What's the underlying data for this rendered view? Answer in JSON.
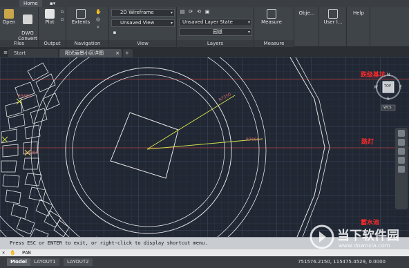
{
  "ribbon_tabs": {
    "home": "Home"
  },
  "panels": {
    "files": {
      "title": "Files",
      "open": "Open",
      "dwg_convert": "DWG\nConvert"
    },
    "output": {
      "title": "Output",
      "plot": "Plot"
    },
    "navigation": {
      "title": "Navigation",
      "extents": "Extents"
    },
    "view": {
      "title": "View",
      "visual_style": "2D Wireframe",
      "named_view": "Unsaved View"
    },
    "layers": {
      "title": "Layers",
      "layer_state": "Unsaved Layer State",
      "current_layer": "园道"
    },
    "measure": {
      "title": "Measure",
      "measure": "Measure"
    },
    "objects": {
      "title": "Obje..."
    },
    "user": {
      "title": "User I..."
    },
    "help": {
      "title": "Help"
    }
  },
  "file_tabs": {
    "start": "Start",
    "drawing": "阳光丽景小区详图"
  },
  "drawing_labels": {
    "label1": "跌级基坑",
    "label2": "路灯",
    "label3": "蓄水池",
    "dim1": "R7350",
    "dim2": "R7000",
    "dim3": "R5600",
    "dim4": "R3000"
  },
  "viewcube": {
    "north": "N",
    "south": "S",
    "east": "E",
    "west": "W",
    "top": "TOP",
    "wcs": "WCS"
  },
  "command": {
    "history": "Press ESC or ENTER to exit, or right-click to display shortcut menu.",
    "current": "PAN"
  },
  "layout_tabs": [
    "Model",
    "LAYOUT1",
    "LAYOUT2"
  ],
  "coordinates": "751576.2150, 115475.4529, 0.0000",
  "watermark": {
    "name": "当下软件园",
    "url": "www.downxia.com"
  },
  "colors": {
    "background": "#212834",
    "grid": "#3a4458",
    "lines": "#e0e0e0",
    "accent_yellow": "#d4e04a",
    "label_red": "#ff2a2a"
  }
}
